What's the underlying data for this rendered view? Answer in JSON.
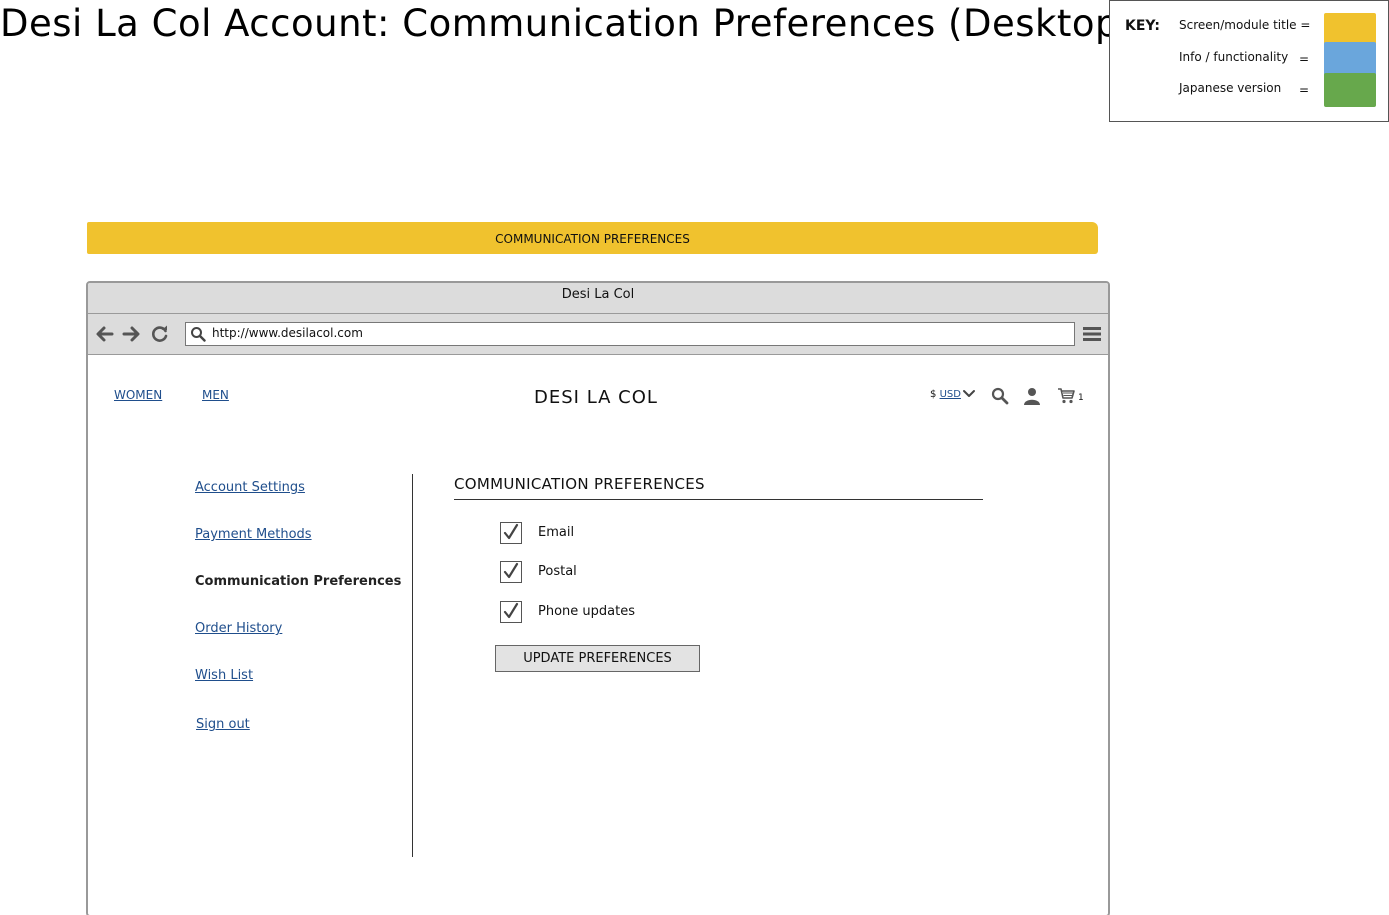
{
  "page_title": "Desi La Col Account: Communication Preferences (Desktop)",
  "key": {
    "label": "KEY:",
    "items": [
      {
        "label": "Screen/module title =",
        "color": "#f0c22e"
      },
      {
        "label": "Info / functionality",
        "eq": "=",
        "color": "#6aa6dc"
      },
      {
        "label": "Japanese version",
        "eq": "=",
        "color": "#67a84c"
      }
    ]
  },
  "banner": {
    "label": "COMMUNICATION PREFERENCES",
    "color": "#f0c22e"
  },
  "browser": {
    "window_title": "Desi La Col",
    "url": "http://www.desilacol.com",
    "icons": [
      "back-arrow-icon",
      "forward-arrow-icon",
      "refresh-icon",
      "search-icon",
      "hamburger-menu-icon"
    ]
  },
  "site": {
    "nav": {
      "women": "WOMEN",
      "men": "MEN"
    },
    "brand": "DESI LA COL",
    "currency_symbol": "$",
    "currency": "USD",
    "cart_count": "1",
    "header_icons": [
      "chevron-down-icon",
      "search-icon",
      "user-icon",
      "cart-icon"
    ]
  },
  "sidebar": {
    "account_settings": "Account Settings",
    "payment_methods": "Payment Methods",
    "communication_preferences": "Communication Preferences",
    "order_history": "Order History",
    "wish_list": "Wish List",
    "sign_out": "Sign out"
  },
  "content": {
    "title": "COMMUNICATION PREFERENCES",
    "options": [
      {
        "label": "Email",
        "checked": true
      },
      {
        "label": "Postal",
        "checked": true
      },
      {
        "label": "Phone updates",
        "checked": true
      }
    ],
    "button_label": "UPDATE PREFERENCES"
  }
}
